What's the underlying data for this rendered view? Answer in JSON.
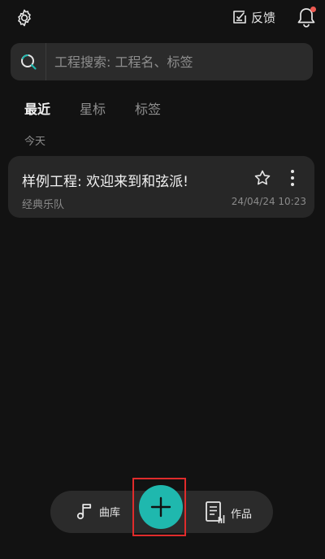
{
  "header": {
    "feedback_label": "反馈",
    "notification_dot_color": "#ee5a52"
  },
  "search": {
    "placeholder": "工程搜索: 工程名、标签"
  },
  "tabs": [
    {
      "label": "最近",
      "active": true
    },
    {
      "label": "星标",
      "active": false
    },
    {
      "label": "标签",
      "active": false
    }
  ],
  "section": {
    "label": "今天"
  },
  "projects": [
    {
      "title": "样例工程: 欢迎来到和弦派!",
      "subtitle": "经典乐队",
      "date": "24/04/24 10:23",
      "starred": false
    }
  ],
  "bottom_nav": {
    "library_label": "曲库",
    "works_label": "作品",
    "add_button_color": "#1fb8ae"
  },
  "icons": [
    "gear-icon",
    "feedback-icon",
    "bell-icon",
    "search-icon",
    "star-icon",
    "more-vertical-icon",
    "music-note-icon",
    "plus-icon",
    "document-icon"
  ]
}
